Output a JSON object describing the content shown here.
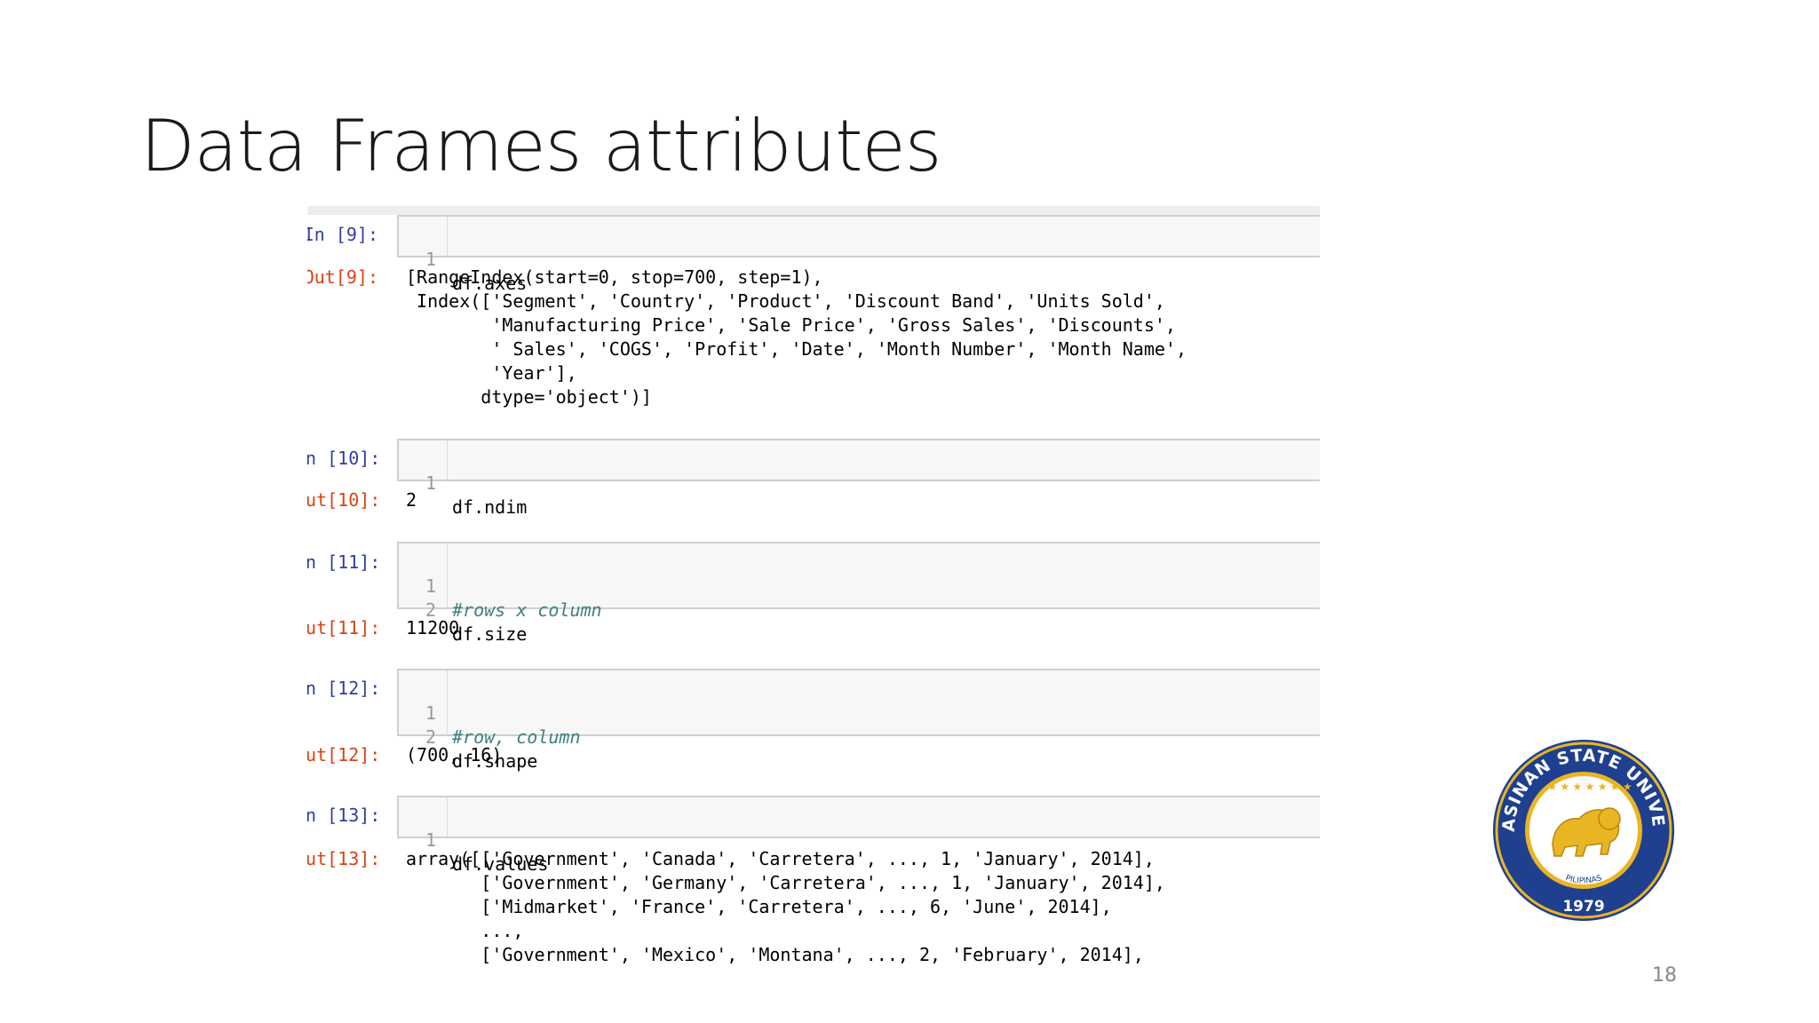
{
  "slide": {
    "title": "Data Frames attributes",
    "page_number": "18"
  },
  "cells": [
    {
      "in_prompt": "In [9]:",
      "lines": [
        {
          "num": "1",
          "code": "df.axes"
        }
      ],
      "out_prompt": "Out[9]:",
      "output": "[RangeIndex(start=0, stop=700, step=1),\n Index(['Segment', 'Country', 'Product', 'Discount Band', 'Units Sold',\n        'Manufacturing Price', 'Sale Price', 'Gross Sales', 'Discounts',\n        ' Sales', 'COGS', 'Profit', 'Date', 'Month Number', 'Month Name',\n        'Year'],\n       dtype='object')]"
    },
    {
      "in_prompt": "In [10]:",
      "lines": [
        {
          "num": "1",
          "code": "df.ndim"
        }
      ],
      "out_prompt": "Out[10]:",
      "output": "2"
    },
    {
      "in_prompt": "In [11]:",
      "lines": [
        {
          "num": "1",
          "code": "#rows x column"
        },
        {
          "num": "2",
          "code": "df.size"
        }
      ],
      "out_prompt": "Out[11]:",
      "output": "11200"
    },
    {
      "in_prompt": "In [12]:",
      "lines": [
        {
          "num": "1",
          "code": "#row, column"
        },
        {
          "num": "2",
          "code": "df.shape"
        }
      ],
      "out_prompt": "Out[12]:",
      "output": "(700, 16)"
    },
    {
      "in_prompt": "In [13]:",
      "lines": [
        {
          "num": "1",
          "code": "df.values"
        }
      ],
      "out_prompt": "Out[13]:",
      "output": "array([['Government', 'Canada', 'Carretera', ..., 1, 'January', 2014],\n       ['Government', 'Germany', 'Carretera', ..., 1, 'January', 2014],\n       ['Midmarket', 'France', 'Carretera', ..., 6, 'June', 2014],\n       ...,\n       ['Government', 'Mexico', 'Montana', ..., 2, 'February', 2014],"
    }
  ],
  "logo": {
    "text_top": "PANGASINAN STATE UNIVERSITY",
    "text_bottom": "1979",
    "text_inner": "PILIPINAS",
    "colors": {
      "ring": "#1f3f8f",
      "gold": "#e9b522",
      "field": "#ffffff"
    }
  }
}
